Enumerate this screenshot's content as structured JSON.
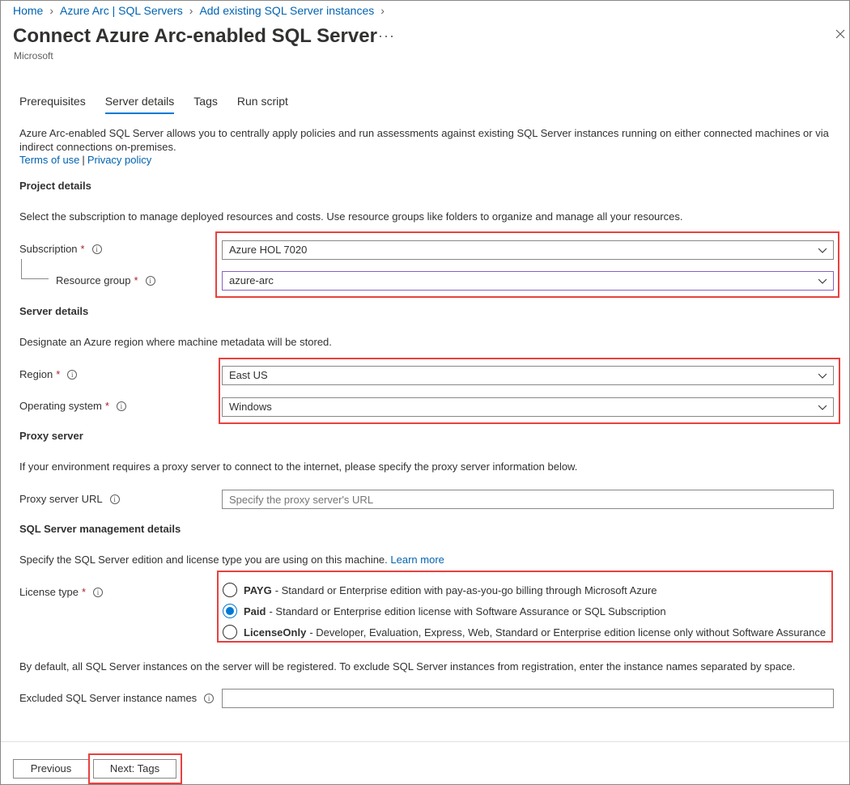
{
  "breadcrumb": [
    {
      "label": "Home"
    },
    {
      "label": "Azure Arc | SQL Servers"
    },
    {
      "label": "Add existing SQL Server instances"
    }
  ],
  "header": {
    "title": "Connect Azure Arc-enabled SQL Server",
    "more": "···",
    "publisher": "Microsoft"
  },
  "tabs": [
    {
      "label": "Prerequisites",
      "active": false
    },
    {
      "label": "Server details",
      "active": true
    },
    {
      "label": "Tags",
      "active": false
    },
    {
      "label": "Run script",
      "active": false
    }
  ],
  "intro": {
    "text": "Azure Arc-enabled SQL Server allows you to centrally apply policies and run assessments against existing SQL Server instances running on either connected machines or via indirect connections on-premises.",
    "terms_link": "Terms of use",
    "separator": "|",
    "privacy_link": "Privacy policy"
  },
  "project": {
    "heading": "Project details",
    "description": "Select the subscription to manage deployed resources and costs. Use resource groups like folders to organize and manage all your resources.",
    "subscription_label": "Subscription",
    "subscription_value": "Azure HOL 7020",
    "resource_group_label": "Resource group",
    "resource_group_value": "azure-arc"
  },
  "server": {
    "heading": "Server details",
    "description": "Designate an Azure region where machine metadata will be stored.",
    "region_label": "Region",
    "region_value": "East US",
    "os_label": "Operating system",
    "os_value": "Windows"
  },
  "proxy": {
    "heading": "Proxy server",
    "description": "If your environment requires a proxy server to connect to the internet, please specify the proxy server information below.",
    "url_label": "Proxy server URL",
    "url_placeholder": "Specify the proxy server's URL"
  },
  "sql": {
    "heading": "SQL Server management details",
    "description": "Specify the SQL Server edition and license type you are using on this machine.",
    "learn_more": "Learn more",
    "license_label": "License type",
    "options": [
      {
        "name": "PAYG",
        "text": "- Standard or Enterprise edition with pay-as-you-go billing through Microsoft Azure",
        "checked": false
      },
      {
        "name": "Paid",
        "text": "- Standard or Enterprise edition license with Software Assurance or SQL Subscription",
        "checked": true
      },
      {
        "name": "LicenseOnly",
        "text": "- Developer, Evaluation, Express, Web, Standard or Enterprise edition license only without Software Assurance",
        "checked": false
      }
    ],
    "exclude_description": "By default, all SQL Server instances on the server will be registered. To exclude SQL Server instances from registration, enter the instance names separated by space.",
    "exclude_label": "Excluded SQL Server instance names",
    "exclude_value": ""
  },
  "footer": {
    "previous": "Previous",
    "next": "Next: Tags"
  },
  "required_marker": "*",
  "info_glyph": "i",
  "colors": {
    "link": "#0063b1",
    "accent": "#0078d4",
    "required": "#a4262c",
    "highlight": "#e8413f"
  }
}
